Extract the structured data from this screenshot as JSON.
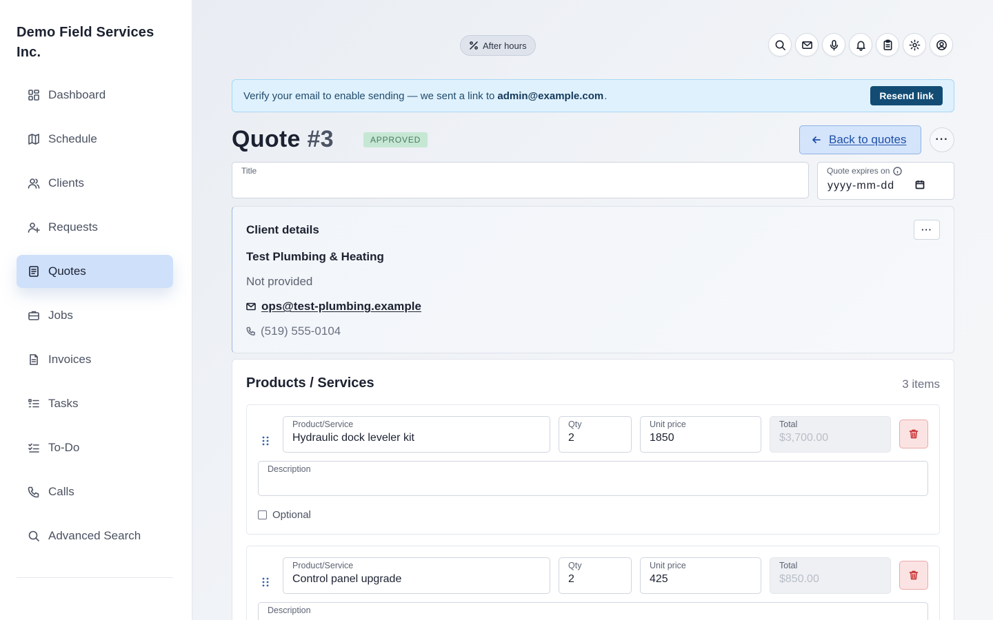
{
  "app": {
    "company": "Demo Field Services Inc."
  },
  "sidebar": {
    "items": [
      {
        "label": "Dashboard",
        "icon": "dashboard-icon"
      },
      {
        "label": "Schedule",
        "icon": "map-icon"
      },
      {
        "label": "Clients",
        "icon": "users-icon"
      },
      {
        "label": "Requests",
        "icon": "user-plus-icon"
      },
      {
        "label": "Quotes",
        "icon": "document-icon",
        "active": true
      },
      {
        "label": "Jobs",
        "icon": "briefcase-icon"
      },
      {
        "label": "Invoices",
        "icon": "file-icon"
      },
      {
        "label": "Tasks",
        "icon": "list-icon"
      },
      {
        "label": "To-Do",
        "icon": "checklist-icon"
      },
      {
        "label": "Calls",
        "icon": "phone-icon"
      },
      {
        "label": "Advanced Search",
        "icon": "search-icon"
      }
    ]
  },
  "header": {
    "after_hours": "After hours",
    "icons": [
      "search-icon",
      "mail-icon",
      "microphone-icon",
      "bell-icon",
      "clipboard-icon",
      "gear-icon",
      "account-icon"
    ]
  },
  "banner": {
    "text": "Verify your email to enable sending — we sent a link to",
    "email": "admin@example.com",
    "trailing": ".",
    "button": "Resend link",
    "color": "#dff1fd"
  },
  "quote": {
    "title_prefix": "Quote",
    "number": "#3",
    "status": "APPROVED",
    "back_label": "Back to quotes",
    "more": "···"
  },
  "form": {
    "title_label": "Title",
    "title_value": "",
    "expires_label": "Quote expires on",
    "expires_placeholder": "yyyy-mm-dd"
  },
  "client": {
    "header": "Client details",
    "more": "···",
    "name": "Test Plumbing & Heating",
    "address": "Not provided",
    "email": "ops@test-plumbing.example",
    "phone": "(519) 555-0104"
  },
  "products": {
    "header": "Products / Services",
    "count": "3 items",
    "labels": {
      "product": "Product/Service",
      "qty": "Qty",
      "unit_price": "Unit price",
      "total": "Total",
      "description": "Description",
      "optional": "Optional"
    },
    "items": [
      {
        "name": "Hydraulic dock leveler kit",
        "qty": "2",
        "unit_price": "1850",
        "total": "$3,700.00",
        "description": "",
        "optional": false
      },
      {
        "name": "Control panel upgrade",
        "qty": "2",
        "unit_price": "425",
        "total": "$850.00",
        "description": ""
      }
    ]
  }
}
